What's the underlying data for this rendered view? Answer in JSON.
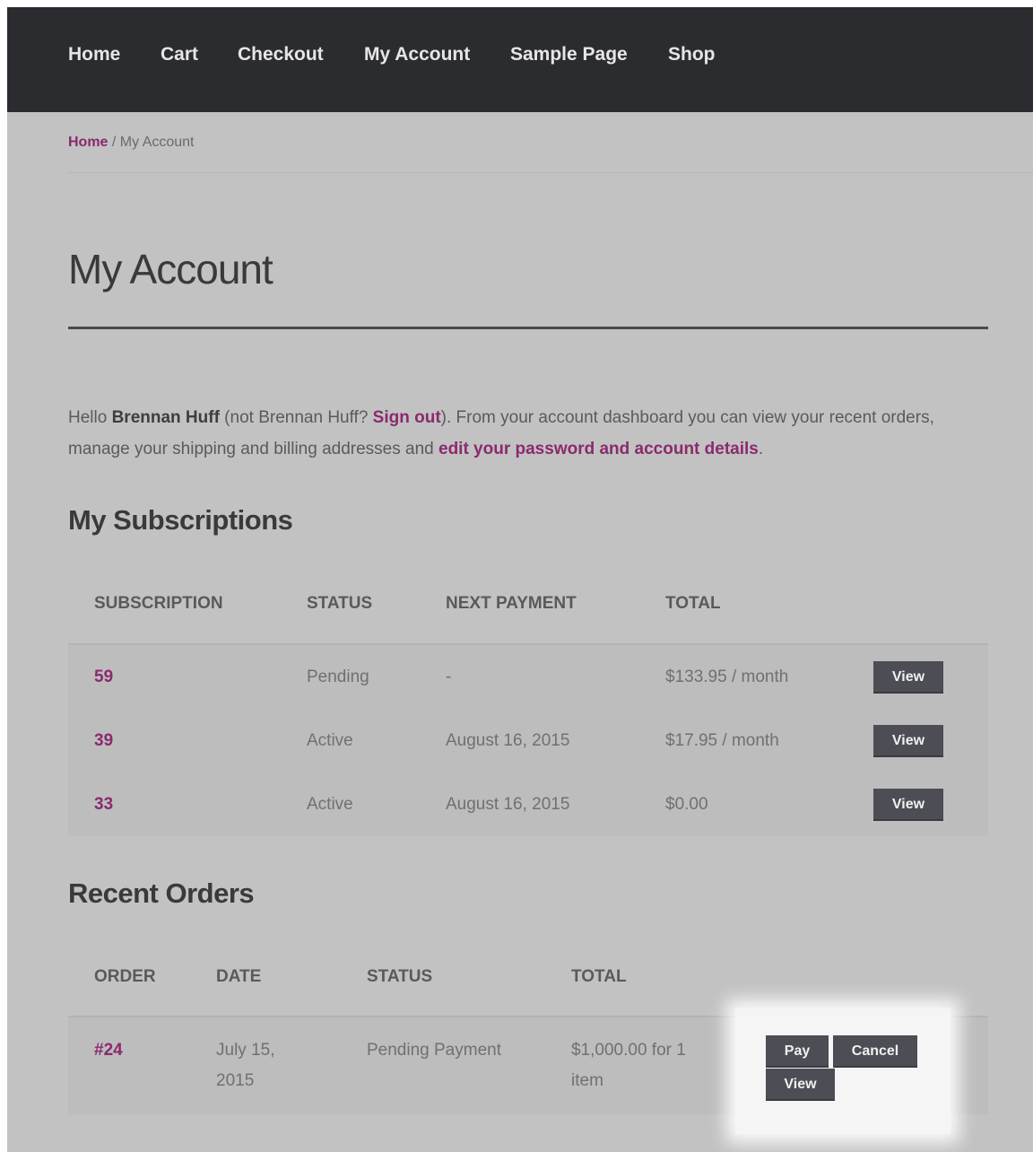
{
  "nav": {
    "items": [
      "Home",
      "Cart",
      "Checkout",
      "My Account",
      "Sample Page",
      "Shop"
    ]
  },
  "breadcrumb": {
    "home": "Home",
    "separator": " / ",
    "current": "My Account"
  },
  "page": {
    "title": "My Account"
  },
  "intro": {
    "hello": "Hello ",
    "user_name": "Brennan Huff",
    "not_prefix": " (not Brennan Huff? ",
    "sign_out": "Sign out",
    "middle": "). From your account dashboard you can view your recent orders, manage your shipping and billing addresses and ",
    "edit_link": "edit your password and account details",
    "end": "."
  },
  "subscriptions": {
    "title": "My Subscriptions",
    "columns": [
      "SUBSCRIPTION",
      "STATUS",
      "NEXT PAYMENT",
      "TOTAL"
    ],
    "rows": [
      {
        "id": "59",
        "status": "Pending",
        "next_payment": "-",
        "total": "$133.95 / month",
        "action": "View"
      },
      {
        "id": "39",
        "status": "Active",
        "next_payment": "August 16, 2015",
        "total": "$17.95 / month",
        "action": "View"
      },
      {
        "id": "33",
        "status": "Active",
        "next_payment": "August 16, 2015",
        "total": "$0.00",
        "action": "View"
      }
    ]
  },
  "orders": {
    "title": "Recent Orders",
    "columns": [
      "ORDER",
      "DATE",
      "STATUS",
      "TOTAL"
    ],
    "rows": [
      {
        "id": "#24",
        "date_line1": "July 15,",
        "date_line2": "2015",
        "status": "Pending Payment",
        "total_line1": "$1,000.00 for 1",
        "total_line2": "item",
        "actions": {
          "pay": "Pay",
          "cancel": "Cancel",
          "view": "View"
        }
      }
    ]
  },
  "colors": {
    "nav_bg": "#2b2c2f",
    "page_bg": "#c2c2c2",
    "link": "#8a2a6e",
    "button_bg": "#4c4d55",
    "highlight": "#f5f5f5"
  }
}
